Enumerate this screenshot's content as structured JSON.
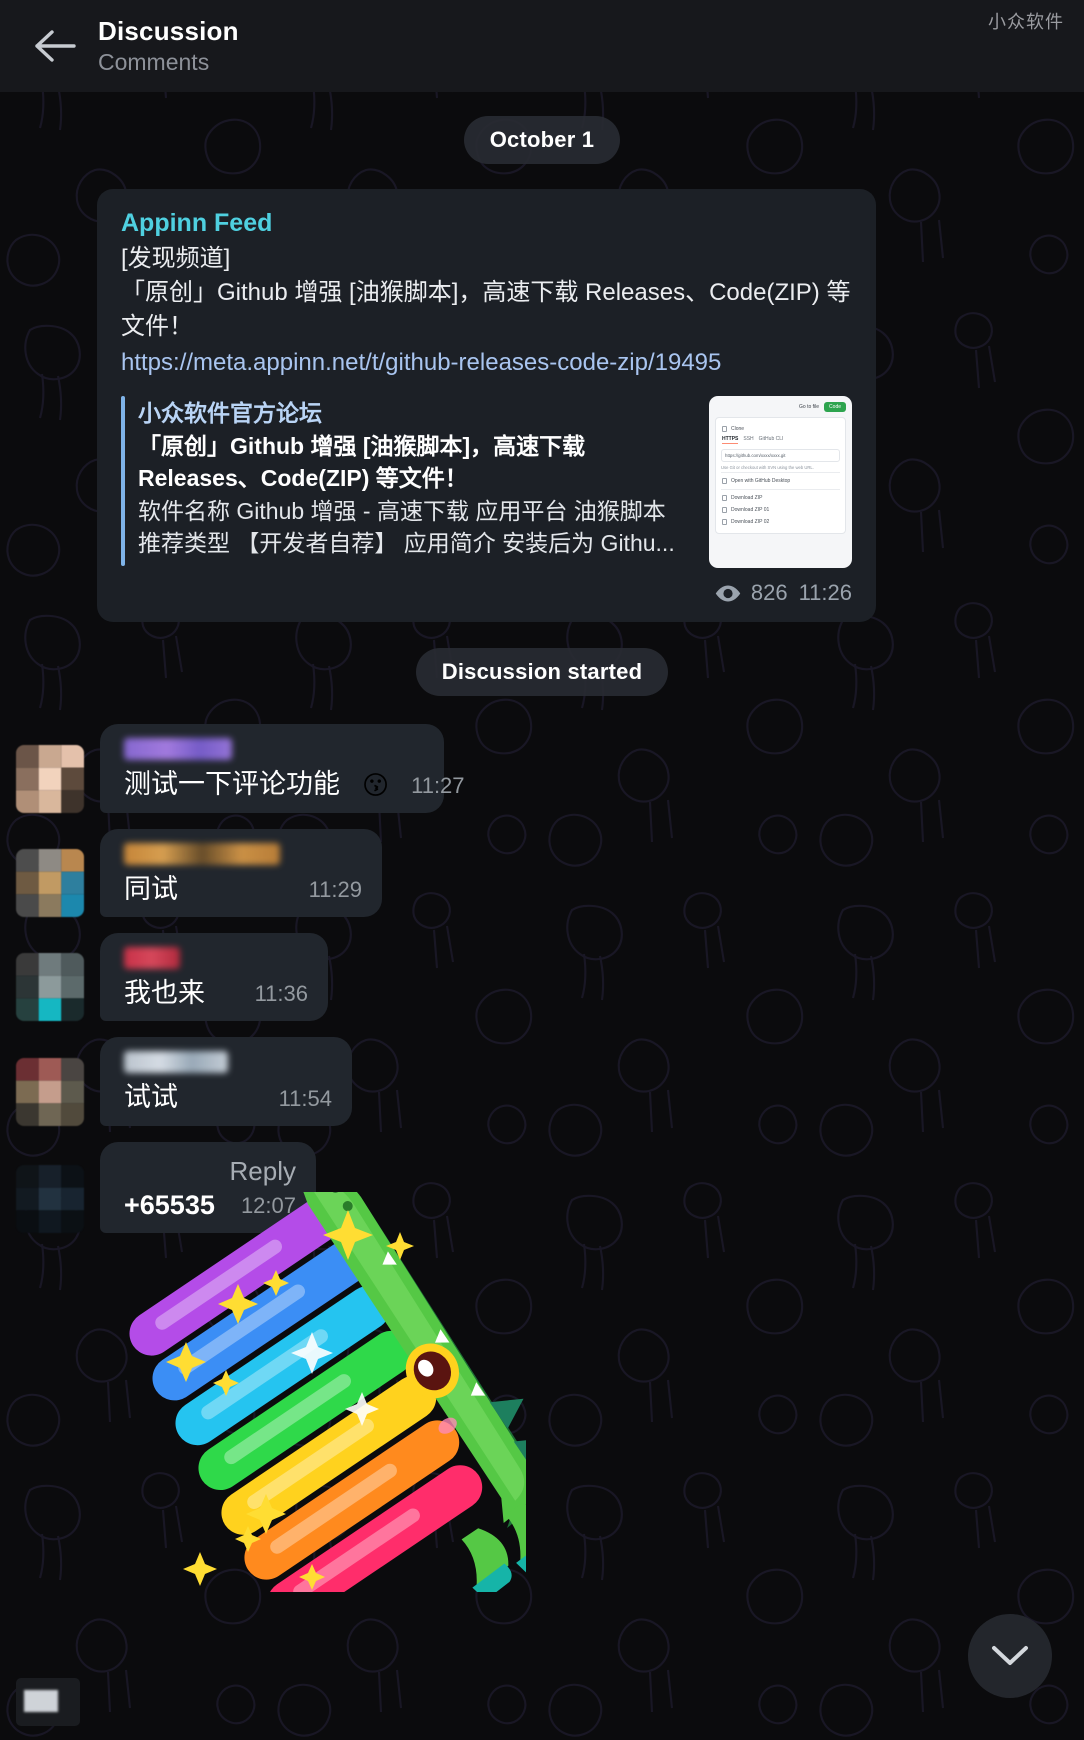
{
  "header": {
    "title": "Discussion",
    "subtitle": "Comments",
    "back_icon": "arrow-left-icon",
    "watermark": "小众软件"
  },
  "service_messages": {
    "date": "October 1",
    "discussion_started": "Discussion started"
  },
  "channel_post": {
    "author": "Appinn Feed",
    "author_color": "#4fd0e0",
    "text_lines": [
      "[发现频道]",
      "「原创」Github 增强 [油猴脚本]，高速下载 Releases、Code(ZIP) 等文件！"
    ],
    "link": "https://meta.appinn.net/t/github-releases-code-zip/19495",
    "preview": {
      "site_name": "小众软件官方论坛",
      "title": "「原创」Github 增强 [油猴脚本]，高速下载 Releases、Code(ZIP) 等文件！",
      "description": "软件名称 Github 增强 - 高速下载  应用平台 油猴脚本 推荐类型 【开发者自荐】  应用简介 安装后为 Githu...",
      "accent_color": "#7fb3e8",
      "thumbnail": {
        "go_to_file": "Go to file",
        "code_button": "Code",
        "clone_label": "Clone",
        "tabs": [
          "HTTPS",
          "SSH",
          "GitHub CLI"
        ],
        "url": "https://github.com/xxxx/xxxx.git",
        "hint": "Use Git or checkout with SVN using the web URL.",
        "rows": [
          "Open with GitHub Desktop",
          "Download ZIP",
          "Download ZIP 01",
          "Download ZIP 02"
        ]
      }
    },
    "views_icon": "eye-icon",
    "views": "826",
    "time": "11:26"
  },
  "comments": [
    {
      "author_blur_color": "#8b6bd8",
      "author_blur_width": 108,
      "avatar_colors": [
        "#6b5548",
        "#c9a890",
        "#e4c1ab",
        "#8a6f5e",
        "#f2d3bd",
        "#5d4a3c",
        "#b08f77",
        "#d9b79c",
        "#3e332b"
      ],
      "text": "测试一下评论功能",
      "emoji": "😗",
      "time": "11:27",
      "bubble_width": 344
    },
    {
      "author_blur_color": "#cf8b3a",
      "author_blur_width": 156,
      "avatar_colors": [
        "#4d4d4d",
        "#8e8a84",
        "#b9874f",
        "#2f6b86",
        "#6e5a42",
        "#c19a63",
        "#2e7f9e",
        "#4a4a4a",
        "#1c88ad"
      ],
      "text": "同试",
      "emoji": "",
      "time": "11:29",
      "bubble_width": 282
    },
    {
      "author_blur_color": "#d2334a",
      "author_blur_width": 56,
      "avatar_colors": [
        "#3a3a3a",
        "#6f7b7d",
        "#4f5a5c",
        "#2c3536",
        "#8c9a9b",
        "#5c6a6b",
        "#26413f",
        "#0f9aa5",
        "#15b7c2"
      ],
      "text": "我也来",
      "emoji": "",
      "time": "11:36",
      "bubble_width": 228
    },
    {
      "author_blur_color": "#c3ccd6",
      "author_blur_width": 104,
      "avatar_colors": [
        "#6b2f33",
        "#9e5a55",
        "#c59d8c",
        "#7c6b52",
        "#a88f6c",
        "#5d5a4d",
        "#3b3730",
        "#6f6654",
        "#514a3c"
      ],
      "text": "试试",
      "emoji": "",
      "time": "11:54",
      "bubble_width": 252
    }
  ],
  "reply_message": {
    "reply_label": "Reply",
    "text": "+65535",
    "time": "12:07",
    "avatar_colors": [
      "#0f1418",
      "#17202a",
      "#1d2b36",
      "#121a21",
      "#223240",
      "#0c1116",
      "#182430",
      "#101820",
      "#0a0e12"
    ],
    "bubble_width": 216
  },
  "sticker": {
    "name": "rainbow-crocodile-sticker",
    "description": "Green crocodile holding a rainbow with sparkles",
    "colors": [
      "#b44ce8",
      "#3b8ef5",
      "#25c4f0",
      "#2fd94a",
      "#ffd21e",
      "#ff8a1e",
      "#ff2d6b"
    ],
    "body_color": "#55c845",
    "sparkle_color": "#ffdd33"
  },
  "scroll_button": {
    "icon": "chevron-down-icon",
    "label": "Scroll to bottom"
  },
  "corner_thumb": {
    "name": "attachment-thumbnail"
  }
}
